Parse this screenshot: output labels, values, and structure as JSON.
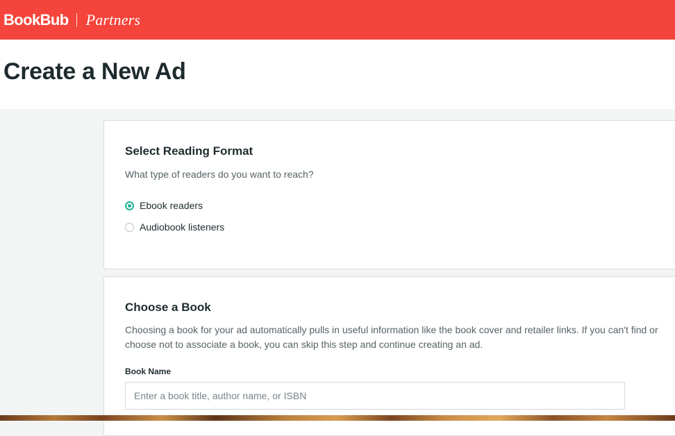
{
  "header": {
    "logo": "BookBub",
    "section": "Partners",
    "brand_color": "#f5443b"
  },
  "page": {
    "title": "Create a New Ad"
  },
  "reading_format": {
    "title": "Select Reading Format",
    "subtitle": "What type of readers do you want to reach?",
    "options": [
      {
        "label": "Ebook readers",
        "selected": true
      },
      {
        "label": "Audiobook listeners",
        "selected": false
      }
    ],
    "accent_color": "#1fb39a"
  },
  "choose_book": {
    "title": "Choose a Book",
    "description": "Choosing a book for your ad automatically pulls in useful information like the book cover and retailer links. If you can't find or choose not to associate a book, you can skip this step and continue creating an ad.",
    "book_name_label": "Book Name",
    "book_name_placeholder": "Enter a book title, author name, or ISBN",
    "book_name_value": ""
  }
}
